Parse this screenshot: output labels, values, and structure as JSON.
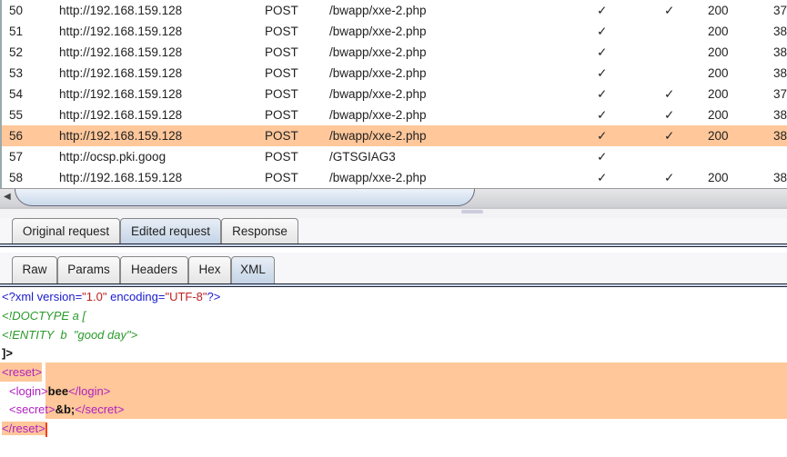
{
  "history": {
    "rows": [
      {
        "num": "50",
        "host": "http://192.168.159.128",
        "method": "POST",
        "url": "/bwapp/xxe-2.php",
        "params": "✓",
        "edited": "✓",
        "status": "200",
        "length": "37"
      },
      {
        "num": "51",
        "host": "http://192.168.159.128",
        "method": "POST",
        "url": "/bwapp/xxe-2.php",
        "params": "✓",
        "edited": "",
        "status": "200",
        "length": "38"
      },
      {
        "num": "52",
        "host": "http://192.168.159.128",
        "method": "POST",
        "url": "/bwapp/xxe-2.php",
        "params": "✓",
        "edited": "",
        "status": "200",
        "length": "38"
      },
      {
        "num": "53",
        "host": "http://192.168.159.128",
        "method": "POST",
        "url": "/bwapp/xxe-2.php",
        "params": "✓",
        "edited": "",
        "status": "200",
        "length": "38"
      },
      {
        "num": "54",
        "host": "http://192.168.159.128",
        "method": "POST",
        "url": "/bwapp/xxe-2.php",
        "params": "✓",
        "edited": "✓",
        "status": "200",
        "length": "37"
      },
      {
        "num": "55",
        "host": "http://192.168.159.128",
        "method": "POST",
        "url": "/bwapp/xxe-2.php",
        "params": "✓",
        "edited": "✓",
        "status": "200",
        "length": "38"
      },
      {
        "num": "56",
        "host": "http://192.168.159.128",
        "method": "POST",
        "url": "/bwapp/xxe-2.php",
        "params": "✓",
        "edited": "✓",
        "status": "200",
        "length": "38",
        "selected": true
      },
      {
        "num": "57",
        "host": "http://ocsp.pki.goog",
        "method": "POST",
        "url": "/GTSGIAG3",
        "params": "✓",
        "edited": "",
        "status": "",
        "length": ""
      },
      {
        "num": "58",
        "host": "http://192.168.159.128",
        "method": "POST",
        "url": "/bwapp/xxe-2.php",
        "params": "✓",
        "edited": "✓",
        "status": "200",
        "length": "38"
      }
    ]
  },
  "request_tabs": [
    {
      "label": "Original request"
    },
    {
      "label": "Edited request",
      "active": true
    },
    {
      "label": "Response"
    }
  ],
  "view_tabs": [
    {
      "label": "Raw"
    },
    {
      "label": "Params"
    },
    {
      "label": "Headers"
    },
    {
      "label": "Hex"
    },
    {
      "label": "XML",
      "active": true
    }
  ],
  "editor": {
    "l1": {
      "a": "<?xml",
      "b": " version=",
      "c": "\"1.0\"",
      "d": " encoding=",
      "e": "\"UTF-8\"",
      "f": "?>"
    },
    "l2": "<!DOCTYPE a [",
    "l3": "<!ENTITY  b  \"good day\">",
    "l4": "]>",
    "l5": "<reset>",
    "l6": {
      "open": "<login>",
      "val": "bee",
      "close": "</login>"
    },
    "l7": {
      "open": "<secret>",
      "val": "&b;",
      "close": "</secret>"
    },
    "l8": "</reset>"
  },
  "colors": {
    "selection": "#ffc79a",
    "tab_active": "#c3d3e6"
  }
}
